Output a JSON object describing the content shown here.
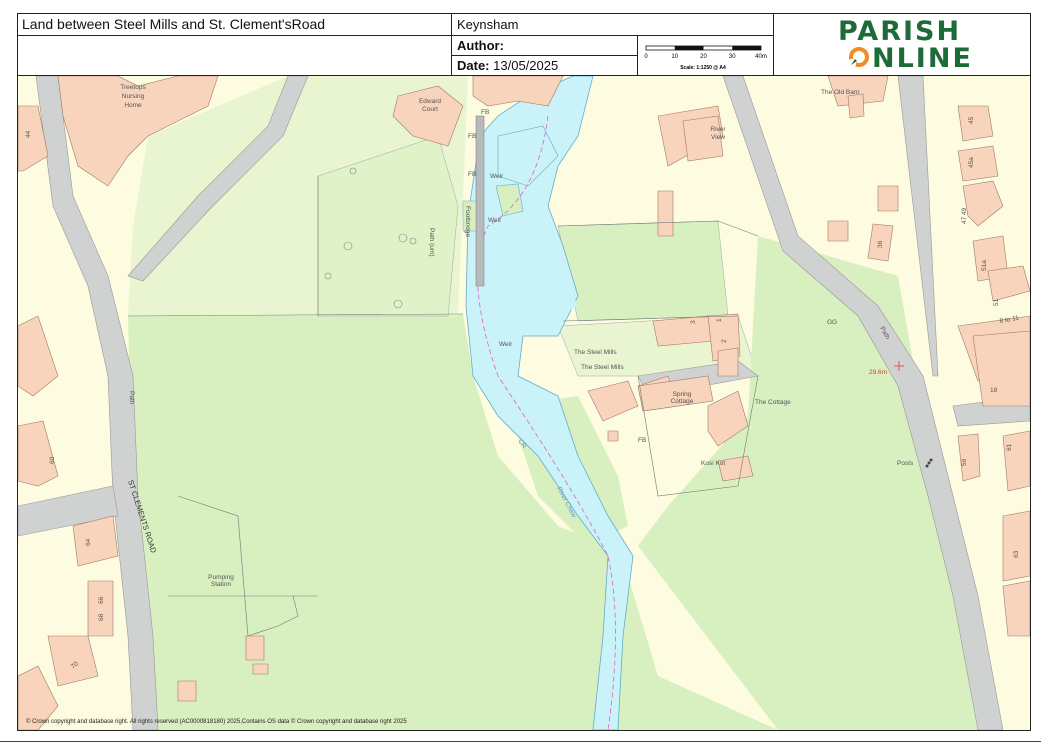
{
  "header": {
    "title": "Land between Steel Mills and St. Clement'sRoad",
    "place": "Keynsham",
    "author_label": "Author:",
    "date_label": "Date:",
    "date_value": "13/05/2025"
  },
  "scale_bar": {
    "ticks": [
      "0",
      "10",
      "20",
      "30",
      "40m"
    ],
    "scale_text": "Scale: 1:1250 @ A4"
  },
  "logo": {
    "line1": "PARISH",
    "line2": "NLINE"
  },
  "colors": {
    "grass": "#d8f0c0",
    "light_green": "#e8f5d0",
    "building": "#f8d4bc",
    "road": "#cfd2d0",
    "yard": "#fdfbe0",
    "water": "#c9f3f8",
    "brand": "#1e6b3a",
    "brand_accent": "#f28c28",
    "spot_height": "#e03b3b"
  },
  "map": {
    "labels": {
      "treetops": [
        "Treetops",
        "Nursing",
        "Home"
      ],
      "edward_court": [
        "Edward",
        "Court"
      ],
      "fb1": "FB",
      "fb2": "FB",
      "fb3": "FB",
      "fb4": "FB",
      "weir1": "Weir",
      "weir2": "Weir",
      "weir3": "Weir",
      "footbridge": "Footbridge",
      "path_um": "Path (um)",
      "path_west": "Path",
      "path_east": "Path",
      "river_view": [
        "River",
        "View"
      ],
      "old_barn": "The Old Barn",
      "steel_mills_1": "The Steel Mills",
      "steel_mills_2": "The Steel Mills",
      "spring_cottage": [
        "Spring",
        "Cottage"
      ],
      "the_cottage": "The Cottage",
      "kosi_kot": "Kosi Kot",
      "pumping": [
        "Pumping",
        "Station"
      ],
      "road_name": "ST CLEMENTS ROAD",
      "river_name": "River Chew",
      "cr": "CR",
      "gg": "GG",
      "posts": "Posts",
      "spot_height": "29.6m",
      "n1": "3",
      "n2": "1",
      "n3": "2",
      "n45": "45",
      "n45a": "45a",
      "n47": "47 49",
      "n51a": "51a",
      "n51": "51",
      "n8to11": "8 to 11",
      "n18": "18",
      "n36": "36",
      "n59": "59",
      "n63": "63",
      "n61": "61",
      "n64": "64",
      "n66": "66",
      "n68": "68",
      "n70": "70",
      "n60": "60",
      "n44": "44"
    },
    "copyright": "© Crown copyright and database right. All rights reserved (AC0000818180) 2025,Contains OS data © Crown copyright and database right 2025"
  }
}
